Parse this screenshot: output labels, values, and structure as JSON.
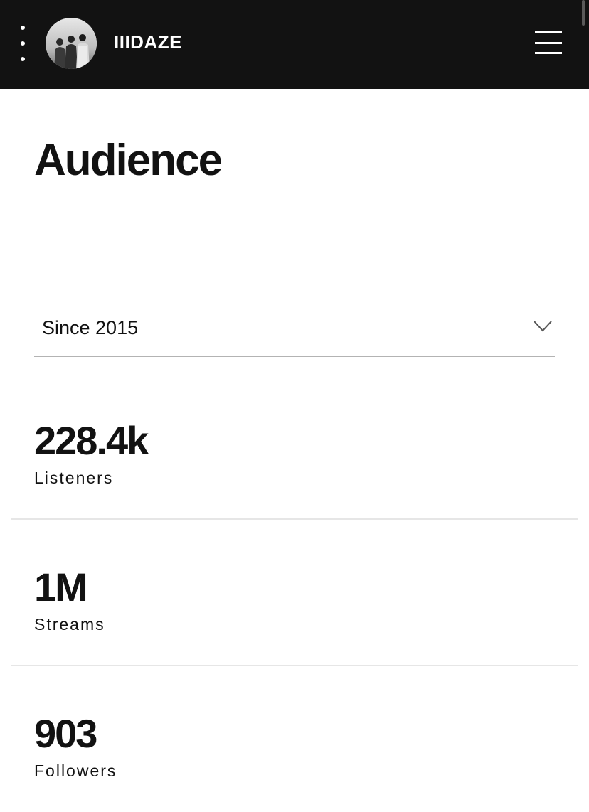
{
  "header": {
    "artist_name": "IIIDAZE",
    "icons": {
      "more": "more-vertical-icon",
      "menu": "hamburger-menu-icon"
    },
    "colors": {
      "background": "#121212",
      "text": "#ffffff"
    }
  },
  "page": {
    "title": "Audience"
  },
  "filter": {
    "selected": "Since 2015",
    "icon": "chevron-down-icon"
  },
  "stats": [
    {
      "value": "228.4k",
      "label": "Listeners"
    },
    {
      "value": "1M",
      "label": "Streams"
    },
    {
      "value": "903",
      "label": "Followers"
    }
  ]
}
